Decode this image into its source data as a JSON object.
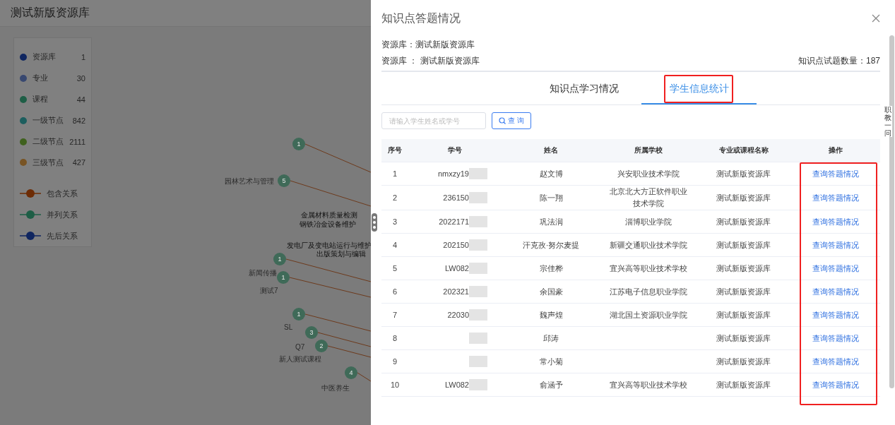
{
  "page": {
    "title": "测试新版资源库"
  },
  "legend": {
    "nodes": [
      {
        "label": "资源库",
        "count": "1",
        "color": "#102660"
      },
      {
        "label": "专业",
        "count": "30",
        "color": "#384870"
      },
      {
        "label": "课程",
        "count": "44",
        "color": "#1e5e46"
      },
      {
        "label": "一级节点",
        "count": "842",
        "color": "#1c5e5e"
      },
      {
        "label": "二级节点",
        "count": "2111",
        "color": "#3f611e"
      },
      {
        "label": "三级节点",
        "count": "427",
        "color": "#785424"
      }
    ],
    "relations": [
      {
        "label": "包含关系",
        "color": "#6d2c05"
      },
      {
        "label": "并列关系",
        "color": "#1e5e46"
      },
      {
        "label": "先后关系",
        "color": "#102660"
      }
    ]
  },
  "graph": {
    "nodes": [
      {
        "count": "1"
      },
      {
        "count": "5",
        "label": "园林艺术与管理"
      },
      {
        "count": "1",
        "label": "新闻传播"
      },
      {
        "count": "1",
        "label": "测试7"
      },
      {
        "count": "1",
        "label": "SL"
      },
      {
        "count": "3",
        "label": "Q7"
      },
      {
        "count": "2",
        "label": "新人测试课程"
      },
      {
        "count": "4",
        "label": "中医养生"
      }
    ],
    "edge_labels": [
      "金属材料质量检测",
      "钢铁冶金设备维护",
      "发电厂及变电站运行与维护",
      "出版策划与编辑"
    ]
  },
  "drawer": {
    "title": "知识点答题情况",
    "info_1": "资源库：测试新版资源库",
    "info_2": "资源库 ： 测试新版资源库",
    "question_count": "知识点试题数量：187",
    "tabs": [
      {
        "label": "知识点学习情况",
        "selected": false,
        "highlighted": false
      },
      {
        "label": "学生信息统计",
        "selected": true,
        "highlighted": true
      }
    ],
    "search": {
      "placeholder": "请输入学生姓名或学号",
      "button": "查 询"
    },
    "table": {
      "columns": [
        {
          "label": "序号",
          "highlighted": false
        },
        {
          "label": "学号",
          "highlighted": false
        },
        {
          "label": "姓名",
          "highlighted": false
        },
        {
          "label": "所属学校",
          "highlighted": false
        },
        {
          "label": "专业或课程名称",
          "highlighted": false
        },
        {
          "label": "操作",
          "highlighted": true
        }
      ],
      "rows": [
        {
          "no": "1",
          "id": "nmxzy19",
          "name": "赵文博",
          "school": "兴安职业技术学院",
          "program": "测试新版资源库",
          "action": "查询答题情况"
        },
        {
          "no": "2",
          "id": "236150",
          "name": "陈一翔",
          "school": "北京北大方正软件职业技术学院",
          "program": "测试新版资源库",
          "action": "查询答题情况"
        },
        {
          "no": "3",
          "id": "2022171",
          "name": "巩法润",
          "school": "淄博职业学院",
          "program": "测试新版资源库",
          "action": "查询答题情况"
        },
        {
          "no": "4",
          "id": "202150",
          "name": "汗克孜·努尔麦提",
          "school": "新疆交通职业技术学院",
          "program": "测试新版资源库",
          "action": "查询答题情况"
        },
        {
          "no": "5",
          "id": "LW082",
          "name": "宗佳桦",
          "school": "宜兴高等职业技术学校",
          "program": "测试新版资源库",
          "action": "查询答题情况"
        },
        {
          "no": "6",
          "id": "202321",
          "name": "余国豪",
          "school": "江苏电子信息职业学院",
          "program": "测试新版资源库",
          "action": "查询答题情况"
        },
        {
          "no": "7",
          "id": "22030",
          "name": "魏声煌",
          "school": "湖北国土资源职业学院",
          "program": "测试新版资源库",
          "action": "查询答题情况"
        },
        {
          "no": "8",
          "name": "邱涛",
          "program": "测试新版资源库",
          "action": "查询答题情况"
        },
        {
          "no": "9",
          "name": "常小菊",
          "program": "测试新版资源库",
          "action": "查询答题情况"
        },
        {
          "no": "10",
          "id": "LW082",
          "name": "俞涵予",
          "school": "宜兴高等职业技术学校",
          "program": "测试新版资源库",
          "action": "查询答题情况"
        }
      ]
    }
  },
  "side_text": "职教一问"
}
